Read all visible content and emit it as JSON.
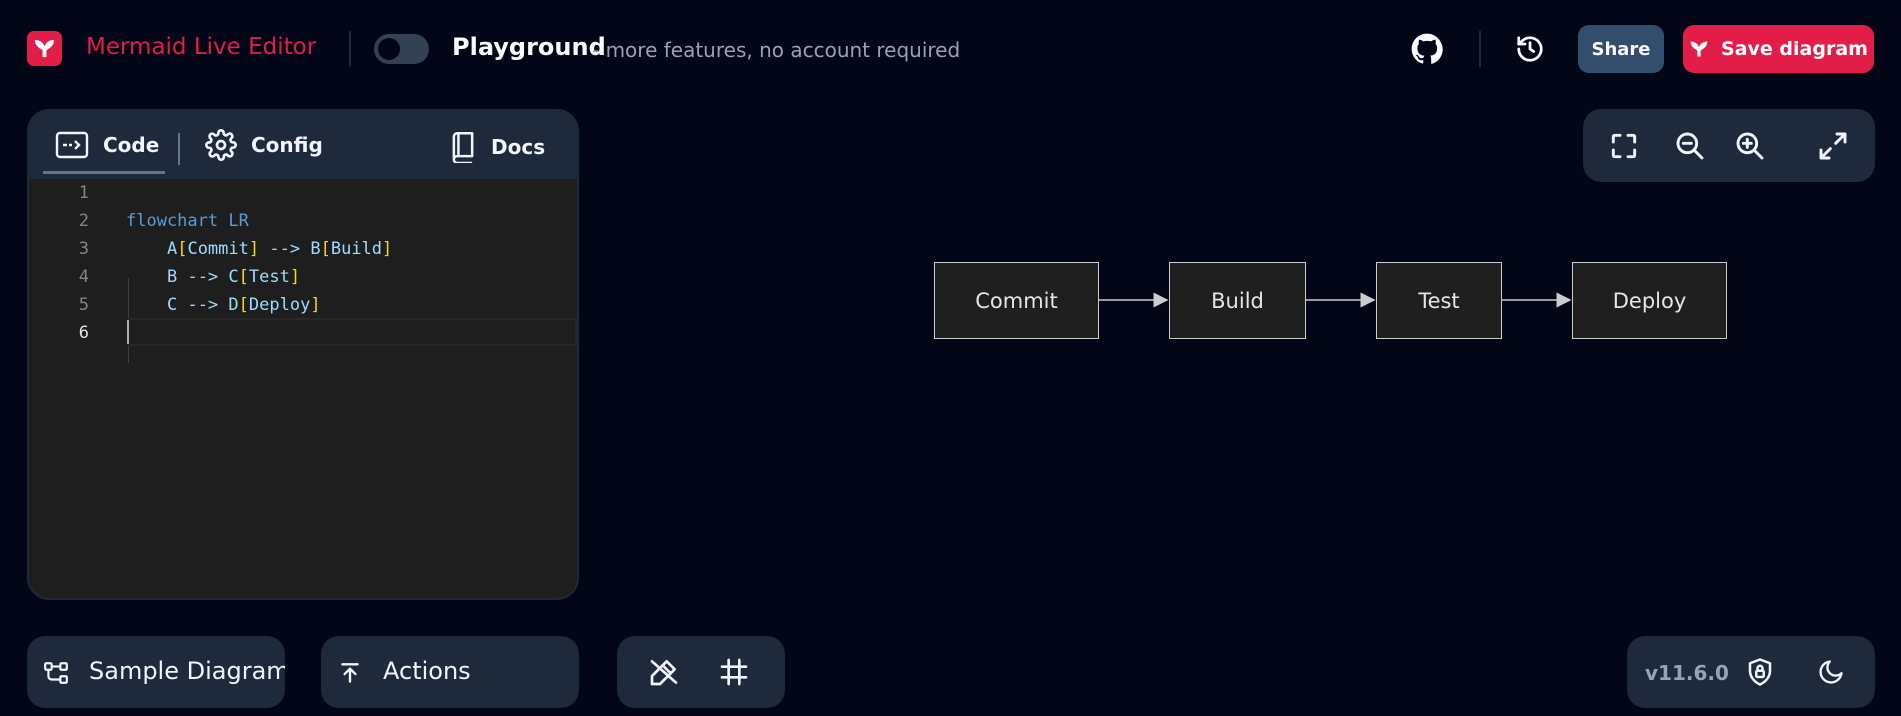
{
  "header": {
    "app_title": "Mermaid Live Editor",
    "mode_title": "Playground",
    "mode_subtitle": "- more features, no account required",
    "share_label": "Share",
    "save_label": "Save diagram"
  },
  "editor": {
    "tabs": [
      {
        "label": "Code",
        "icon": "code-icon",
        "active": true
      },
      {
        "label": "Config",
        "icon": "gear-icon",
        "active": false
      },
      {
        "label": "Docs",
        "icon": "book-icon",
        "active": false
      }
    ],
    "line_numbers": [
      "1",
      "2",
      "3",
      "4",
      "5",
      "6"
    ],
    "lines": [
      "",
      "flowchart LR",
      "    A[Commit] --> B[Build]",
      "    B --> C[Test]",
      "    C --> D[Deploy]",
      ""
    ],
    "tokens": {
      "l2a": "flowchart",
      "l2b": "LR",
      "l3a": "A",
      "l3b": "[",
      "l3c": "Commit",
      "l3d": "]",
      "l3e": "-->",
      "l3f": "B",
      "l3g": "[",
      "l3h": "Build",
      "l3i": "]",
      "l4a": "B",
      "l4b": "-->",
      "l4c": "C",
      "l4d": "[",
      "l4e": "Test",
      "l4f": "]",
      "l5a": "C",
      "l5b": "-->",
      "l5c": "D",
      "l5d": "[",
      "l5e": "Deploy",
      "l5f": "]"
    }
  },
  "diagram": {
    "type": "flowchart",
    "direction": "LR",
    "nodes": [
      {
        "id": "A",
        "label": "Commit"
      },
      {
        "id": "B",
        "label": "Build"
      },
      {
        "id": "C",
        "label": "Test"
      },
      {
        "id": "D",
        "label": "Deploy"
      }
    ],
    "edges": [
      [
        "A",
        "B"
      ],
      [
        "B",
        "C"
      ],
      [
        "C",
        "D"
      ]
    ],
    "node_fill": "#1f1f1f",
    "node_stroke": "#cccccc"
  },
  "bottom": {
    "sample_label": "Sample Diagrams",
    "actions_label": "Actions",
    "version": "v11.6.0"
  },
  "colors": {
    "background": "#020617",
    "accent": "#e11d48",
    "panel": "#1e293b",
    "share": "#334e6c"
  }
}
